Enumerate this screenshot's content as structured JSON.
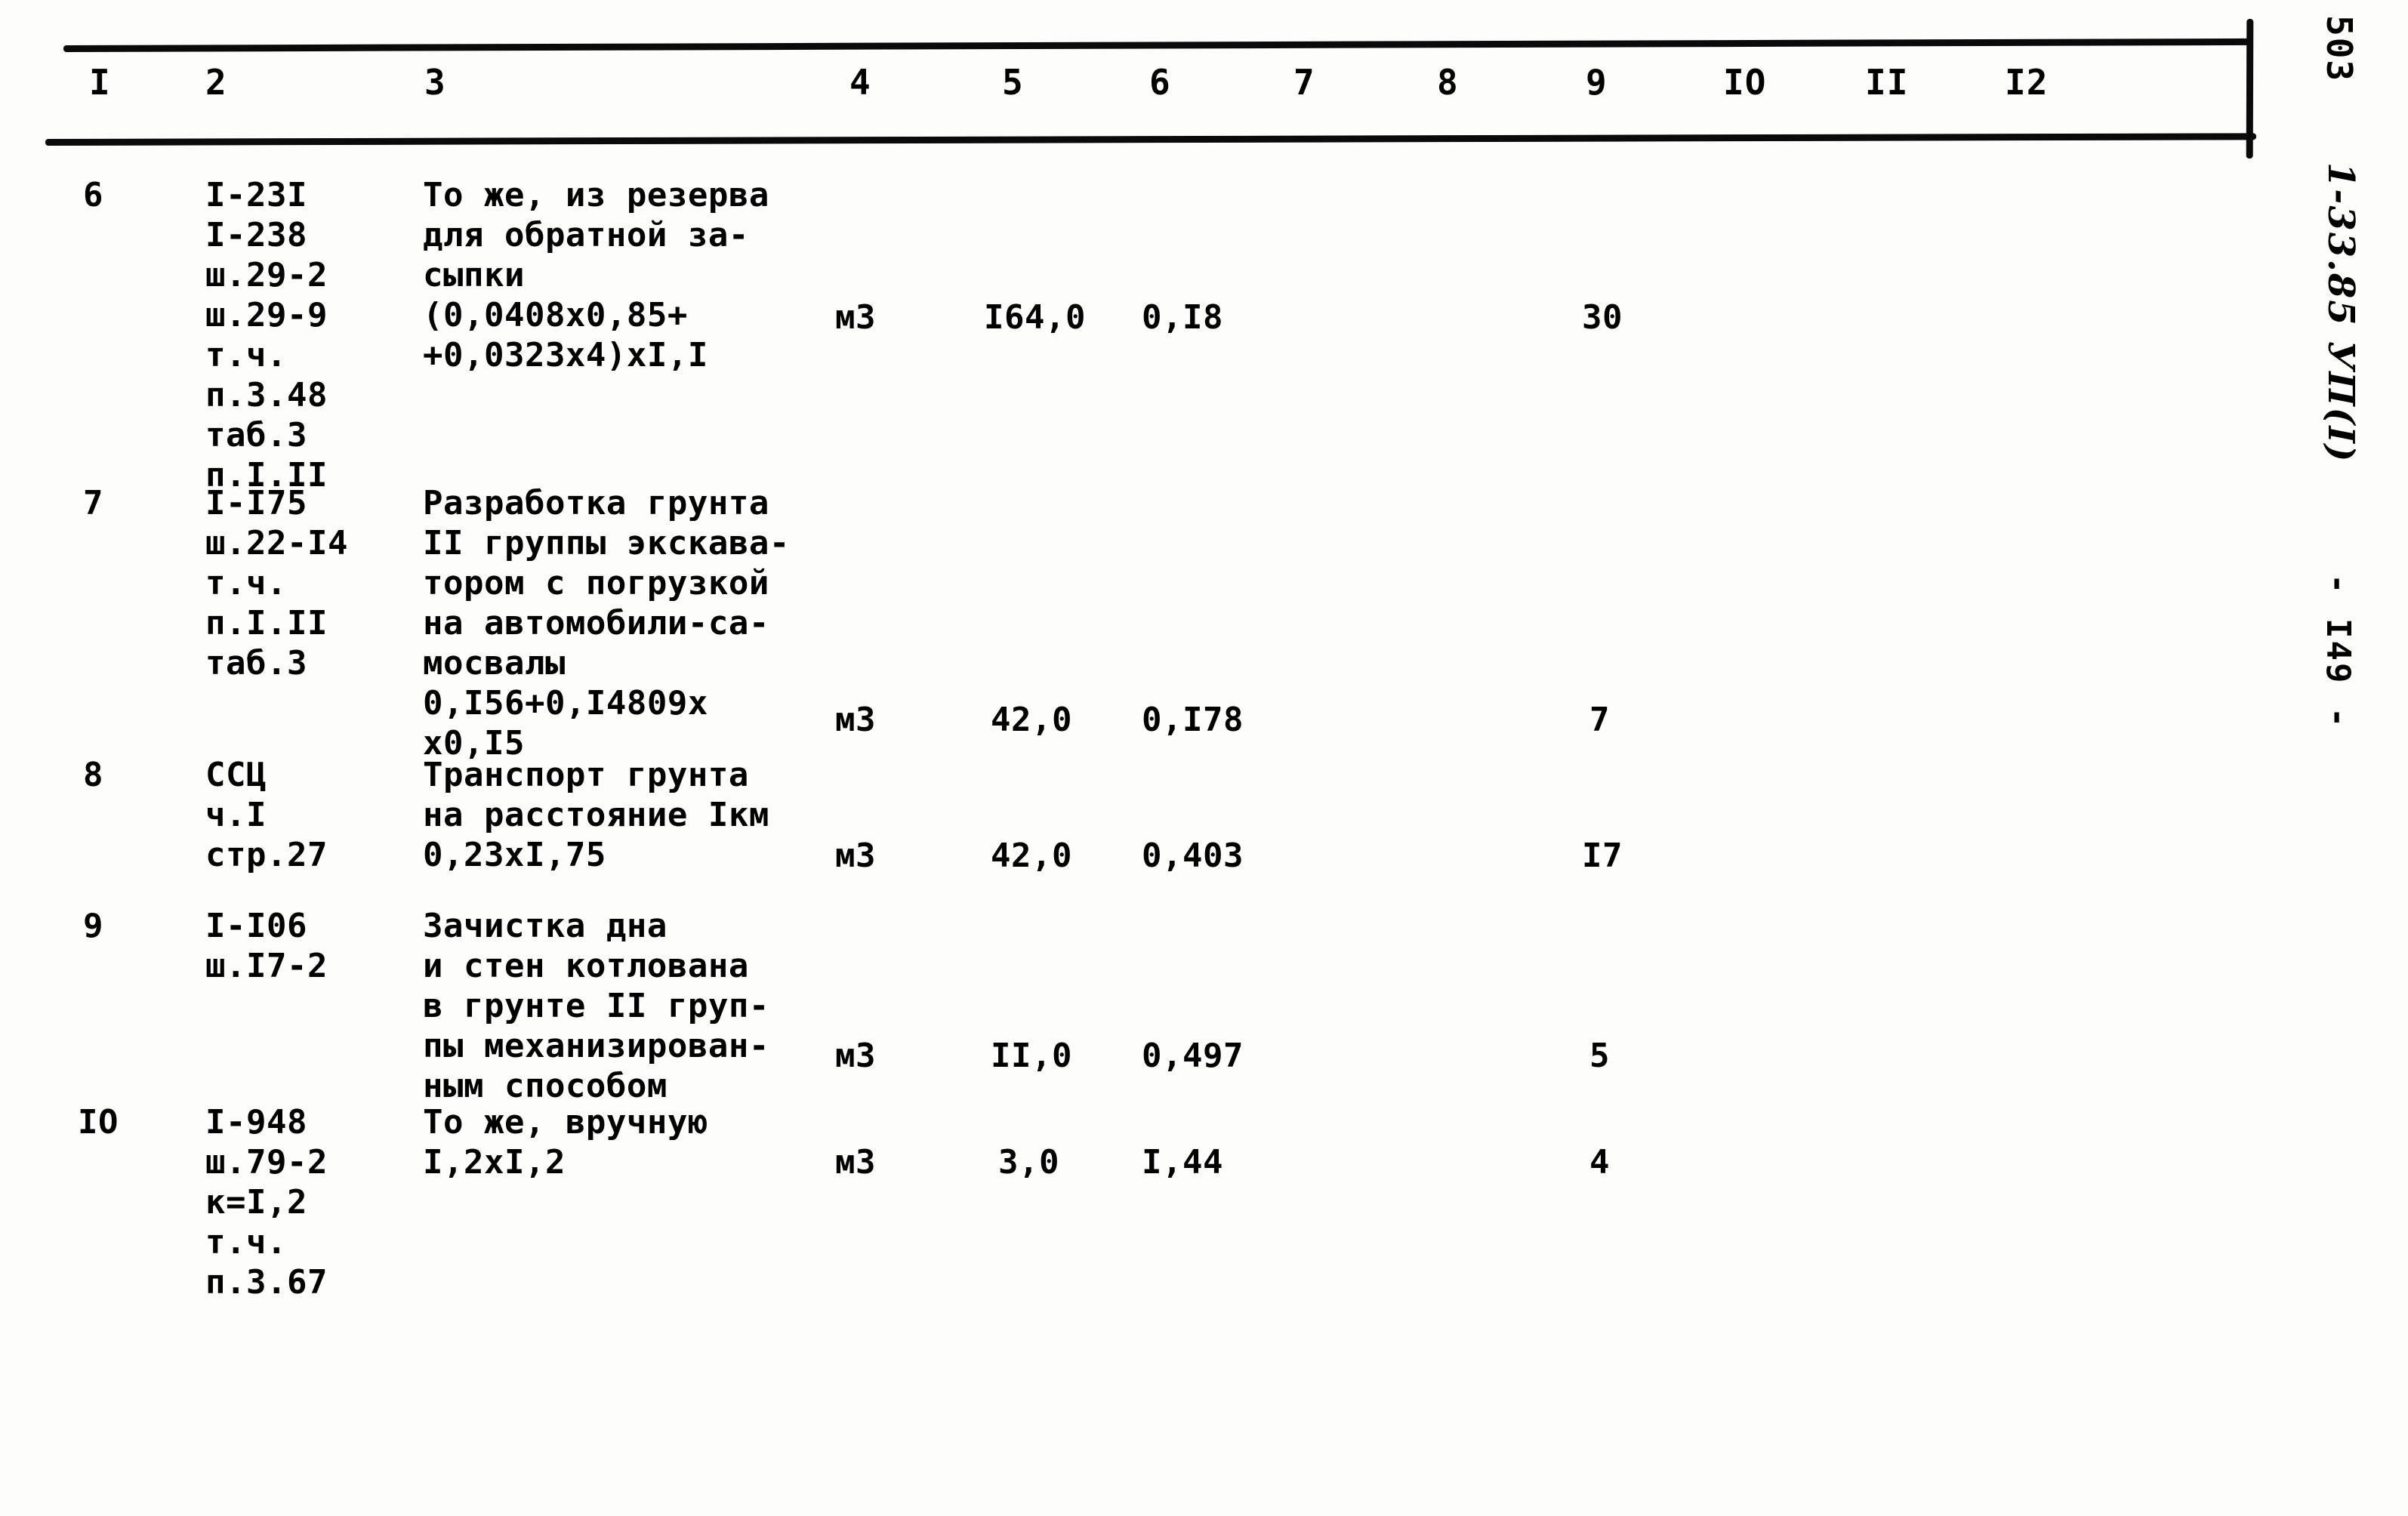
{
  "document": {
    "sheet_number": "503",
    "handwritten_code": "1-33.85 УП(I)",
    "page_marker": "- I49 -"
  },
  "table": {
    "column_numbers": [
      "I",
      "2",
      "3",
      "4",
      "5",
      "6",
      "7",
      "8",
      "9",
      "IO",
      "II",
      "I2"
    ],
    "rows": [
      {
        "position": "6",
        "codes": "I-23I\nI-238\nш.29-2\nш.29-9\nт.ч.\nп.3.48\nтаб.3\nп.I.II",
        "description": "То же, из резерва\nдля обратной за-\nсыпки\n(0,0408х0,85+\n+0,0323х4)хI,I",
        "unit": "м3",
        "quantity": "I64,0",
        "price": "0,I8",
        "col7": "",
        "col8": "",
        "col9": "30",
        "col10": "",
        "col11": "",
        "col12": ""
      },
      {
        "position": "7",
        "codes": "I-I75\nш.22-I4\nт.ч.\nп.I.II\nтаб.3",
        "description": "Разработка грунта\nII группы экскава-\nтором с погрузкой\nна автомобили-са-\nмосвалы\n0,I56+0,I4809х\nх0,I5",
        "unit": "м3",
        "quantity": "42,0",
        "price": "0,I78",
        "col7": "",
        "col8": "",
        "col9": "7",
        "col10": "",
        "col11": "",
        "col12": ""
      },
      {
        "position": "8",
        "codes": "ССЦ\nч.I\nстр.27",
        "description": "Транспорт грунта\nна расстояние Iкм\n0,23хI,75",
        "unit": "м3",
        "quantity": "42,0",
        "price": "0,403",
        "col7": "",
        "col8": "",
        "col9": "I7",
        "col10": "",
        "col11": "",
        "col12": ""
      },
      {
        "position": "9",
        "codes": "I-I06\nш.I7-2",
        "description": "Зачистка дна\nи стен котлована\nв грунте II груп-\nпы механизирован-\nным способом",
        "unit": "м3",
        "quantity": "II,0",
        "price": "0,497",
        "col7": "",
        "col8": "",
        "col9": "5",
        "col10": "",
        "col11": "",
        "col12": ""
      },
      {
        "position": "IO",
        "codes": "I-948\nш.79-2\nк=I,2\nт.ч.\nп.3.67",
        "description": "То же, вручную\nI,2хI,2",
        "unit": "м3",
        "quantity": "3,0",
        "price": "I,44",
        "col7": "",
        "col8": "",
        "col9": "4",
        "col10": "",
        "col11": "",
        "col12": ""
      }
    ]
  }
}
